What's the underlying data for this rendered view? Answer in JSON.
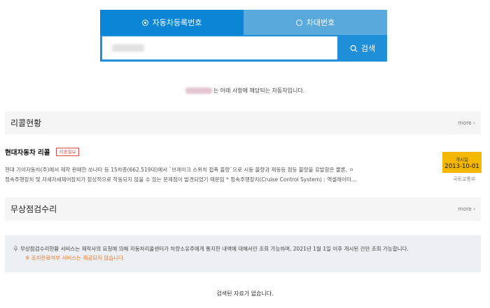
{
  "search": {
    "tabs": [
      {
        "label": "자동차등록번호",
        "active": true
      },
      {
        "label": "차대번호",
        "active": false
      }
    ],
    "button_label": "검색"
  },
  "result_line": "는 아래 사항에 해당되는 자동차입니다.",
  "recall_section": {
    "title": "리콜현황",
    "more": "more",
    "item": {
      "title": "현대자동차 리콜",
      "badge": "리콜필요",
      "desc_line1": "현대 기아자동차(주)에서 제작 판매한 쏘나타 등 15차종(662,519대)에서 `브레이크 스위치 접촉 불량`으로 시동 불량과 제동등 점등 불량을 유발함은 물론, ㅇ",
      "desc_line2": "정속주행장치 및 자세자세제어장치가 정상적으로 작동되지 않을 수 있는 문제점이 발견되었기 때문임 * 정속주행장치(Cruise Control System) : 엑셀레이터…",
      "date_label": "개시일",
      "date_value": "2013-10-01",
      "agency": "국토교통부"
    }
  },
  "free_inspection_section": {
    "title": "무상점검수리",
    "more": "more"
  },
  "notice": {
    "line1": "무상점검수리현황 서비스는 제작사의 요청에 의해 자동차리콜센터가 차량소유주에게 통지한 내역에 대해서만 조회 가능하며, 2021년 1월 1일 이후 개시된 건만 조회 가능합니다.",
    "line2": "※ 조치완료여부 서비스는 제공되지 않습니다."
  },
  "empty_message": "검색된 자료가 없습니다.",
  "colors": {
    "primary": "#0b86d6",
    "tab_inactive": "#5aa9dc",
    "badge_red": "#e8484e",
    "date_yellow": "#f5b800",
    "warn_orange": "#f07a2a"
  }
}
